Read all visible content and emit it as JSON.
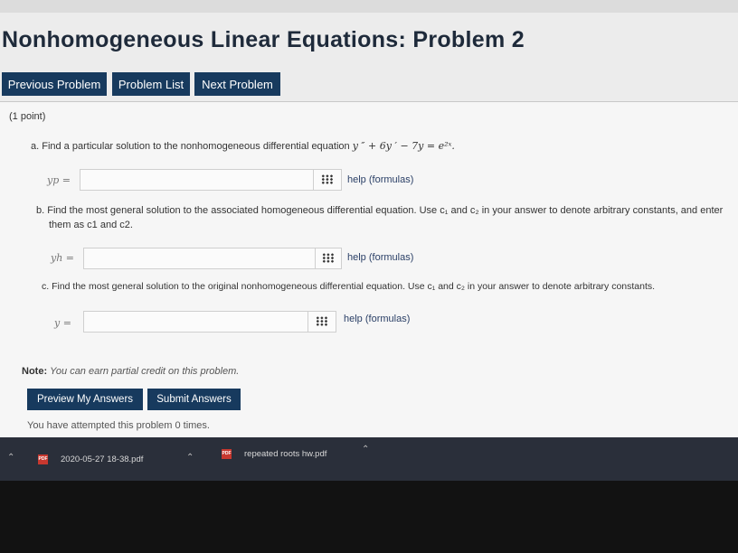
{
  "page": {
    "title": "Nonhomogeneous Linear Equations: Problem 2"
  },
  "nav": {
    "previous": "Previous Problem",
    "list": "Problem List",
    "next": "Next Problem"
  },
  "problem": {
    "points": "(1 point)",
    "part_a": {
      "text": "a. Find a particular solution to the nonhomogeneous differential equation ",
      "equation": "y ″ + 6y ′ − 7y = e²ˣ.",
      "label": "yp =",
      "help": "help (formulas)"
    },
    "part_b": {
      "text_line1": "b. Find the most general solution to the associated homogeneous differential equation. Use c₁ and c₂ in your answer to denote arbitrary constants, and enter",
      "text_line2": "them as c1 and c2.",
      "label": "yh =",
      "help": "help (formulas)"
    },
    "part_c": {
      "text": "c. Find the most general solution to the original nonhomogeneous differential equation. Use c₁ and c₂ in your answer to denote arbitrary constants.",
      "label": "y =",
      "help": "help (formulas)"
    },
    "note_label": "Note:",
    "note_text": "You can earn partial credit on this problem."
  },
  "actions": {
    "preview": "Preview My Answers",
    "submit": "Submit Answers"
  },
  "status": {
    "attempts": "You have attempted this problem 0 times."
  },
  "downloads": [
    {
      "name": "2020-05-27 18-38.pdf",
      "icon": "pdf-icon"
    },
    {
      "name": "repeated roots hw.pdf",
      "icon": "pdf-icon"
    }
  ],
  "colors": {
    "button_bg": "#173a5e",
    "title": "#1e2a3a",
    "taskbar": "#2a2f3a"
  }
}
